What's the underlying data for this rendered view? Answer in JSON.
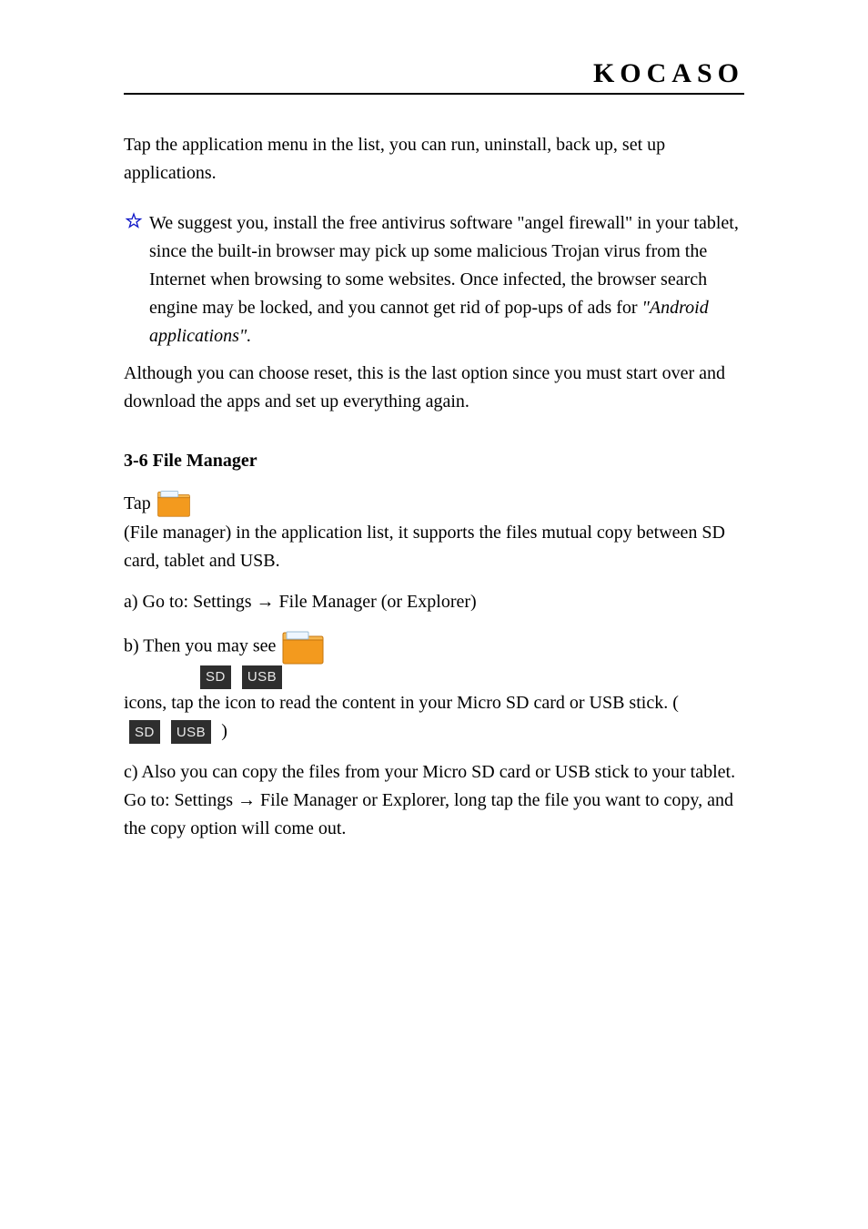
{
  "header": {
    "brand": "KOCASO"
  },
  "body": {
    "p1": "Tap the application menu in the list, you can run, uninstall, back up, set up applications.",
    "star_text": "We suggest you, install the free antivirus software \"angel firewall\" in your tablet, since the built-in browser may pick up some malicious Trojan virus from the Internet when browsing to some websites. Once infected, the browser search engine may be locked, and you cannot get rid of pop-ups of ads for",
    "italic_suffix": "\"Android applications\".",
    "after_star": "Although you can choose reset, this is the last option since you must start over and download the apps and set up everything again.",
    "section_title": "3-6 File Manager",
    "fm1_a": "Tap ",
    "fm1_b": " (File manager) in the application list, it supports the files mutual copy between SD card, tablet and USB.",
    "fm2_a": "a) Go to: Settings ",
    "fm2_arrow": "→",
    "fm2_b": " File Manager (or Explorer)",
    "fm3_a": "b) Then you may see ",
    "fm3_b": " icons, tap the icon to read the content in your Micro SD card or USB stick. (",
    "fm3_c": ")",
    "fm4_a": "c) Also you can copy the files from your Micro SD card or USB stick to your tablet. Go to: Settings ",
    "fm4_arrow": "→",
    "fm4_b": " File Manager or Explorer, long tap the file you want to copy, and the copy option will come out.",
    "badges": {
      "sd": "SD",
      "usb": "USB"
    }
  },
  "icons": {
    "star": "star-icon",
    "folder": "folder-icon"
  }
}
